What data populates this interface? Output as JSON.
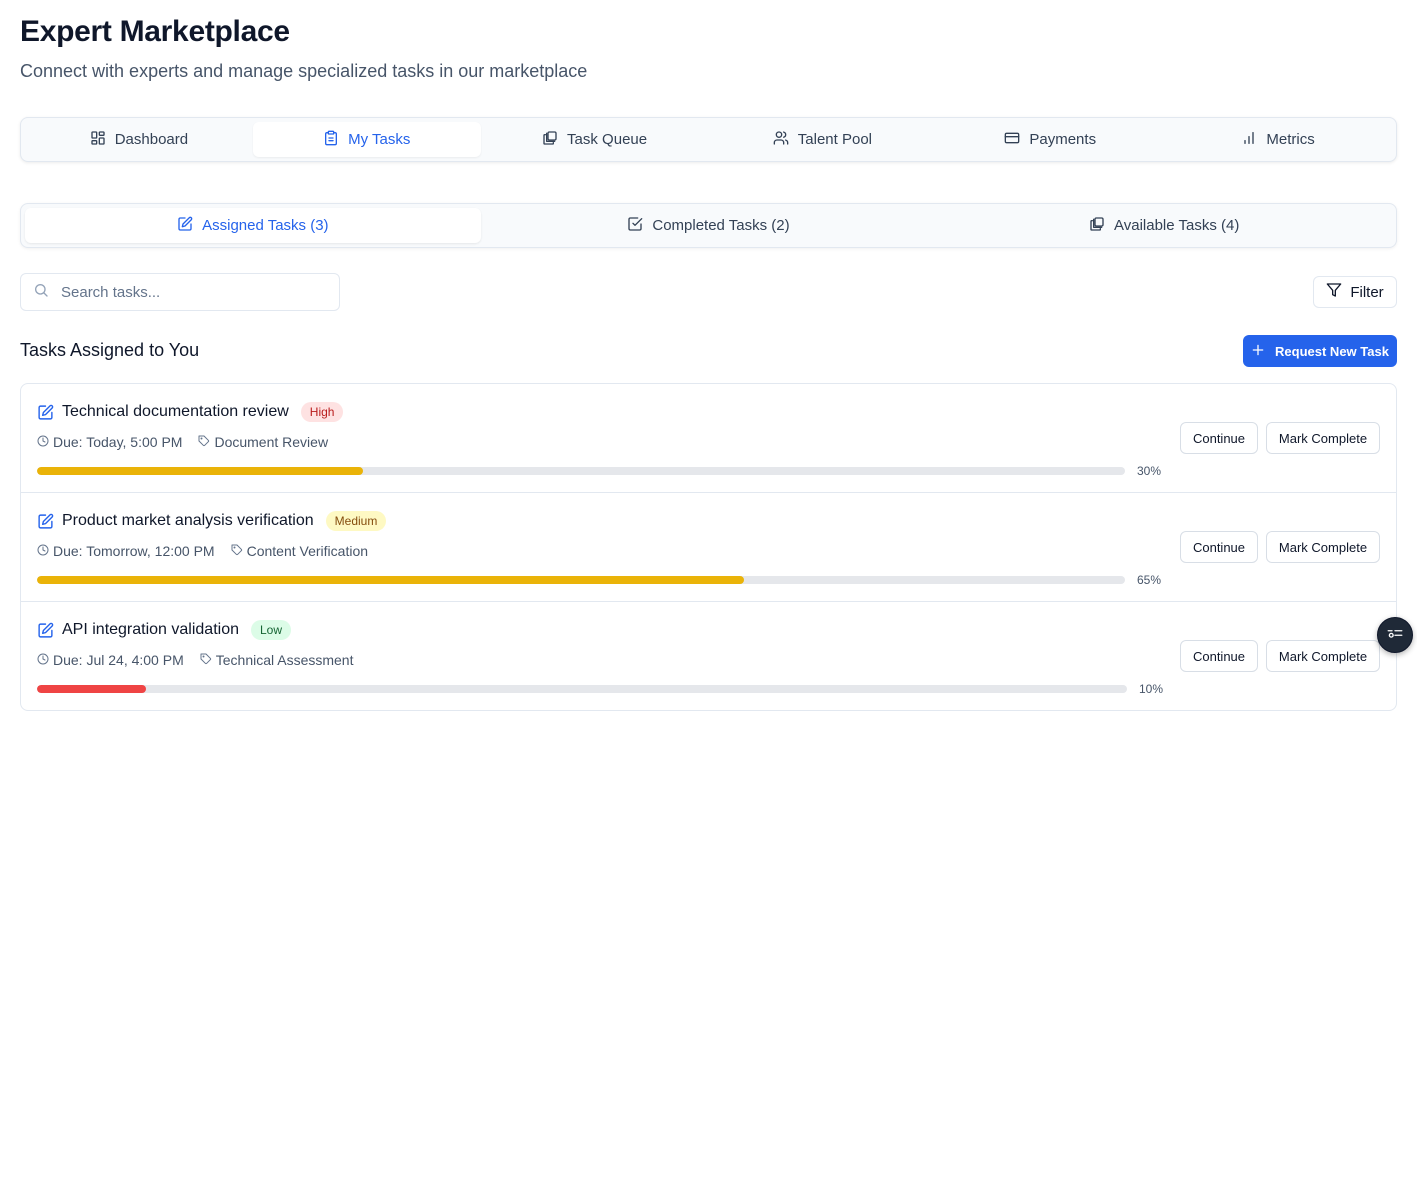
{
  "header": {
    "title": "Expert Marketplace",
    "subtitle": "Connect with experts and manage specialized tasks in our marketplace"
  },
  "main_tabs": [
    {
      "label": "Dashboard",
      "icon": "dashboard-icon",
      "active": false
    },
    {
      "label": "My Tasks",
      "icon": "clipboard-icon",
      "active": true
    },
    {
      "label": "Task Queue",
      "icon": "copy-icon",
      "active": false
    },
    {
      "label": "Talent Pool",
      "icon": "users-icon",
      "active": false
    },
    {
      "label": "Payments",
      "icon": "credit-card-icon",
      "active": false
    },
    {
      "label": "Metrics",
      "icon": "bar-chart-icon",
      "active": false
    }
  ],
  "sub_tabs": [
    {
      "label": "Assigned Tasks (3)",
      "icon": "edit-icon",
      "active": true
    },
    {
      "label": "Completed Tasks (2)",
      "icon": "check-square-icon",
      "active": false
    },
    {
      "label": "Available Tasks (4)",
      "icon": "copy-icon",
      "active": false
    }
  ],
  "search": {
    "placeholder": "Search tasks...",
    "value": ""
  },
  "filter_label": "Filter",
  "section_title": "Tasks Assigned to You",
  "request_button_label": "Request New Task",
  "tasks": [
    {
      "title": "Technical documentation review",
      "priority": "High",
      "due": "Due: Today, 5:00 PM",
      "category": "Document Review",
      "progress": 30,
      "progress_label": "30%",
      "bar_color": "#eab308",
      "continue_label": "Continue",
      "complete_label": "Mark Complete"
    },
    {
      "title": "Product market analysis verification",
      "priority": "Medium",
      "due": "Due: Tomorrow, 12:00 PM",
      "category": "Content Verification",
      "progress": 65,
      "progress_label": "65%",
      "bar_color": "#eab308",
      "continue_label": "Continue",
      "complete_label": "Mark Complete"
    },
    {
      "title": "API integration validation",
      "priority": "Low",
      "due": "Due: Jul 24, 4:00 PM",
      "category": "Technical Assessment",
      "progress": 10,
      "progress_label": "10%",
      "bar_color": "#ef4444",
      "continue_label": "Continue",
      "complete_label": "Mark Complete"
    }
  ],
  "colors": {
    "accent": "#2563eb",
    "high_badge": "#fee2e2",
    "medium_badge": "#fef9c3",
    "low_badge": "#dcfce7"
  }
}
